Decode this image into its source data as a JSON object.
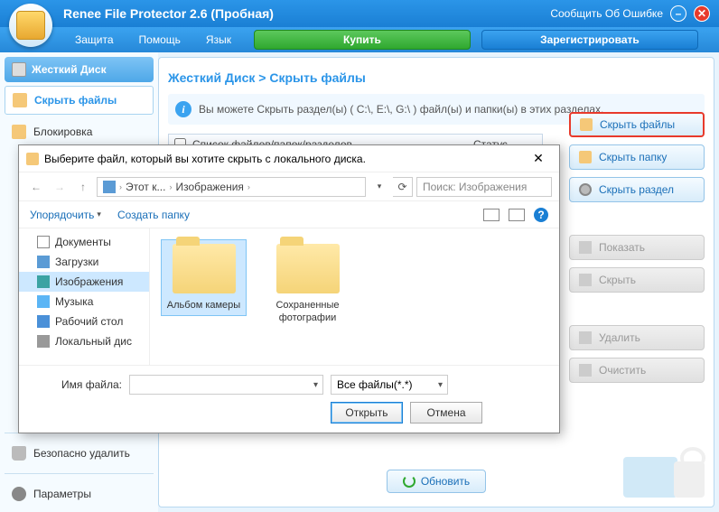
{
  "titlebar": {
    "title": "Renee File Protector 2.6 (Пробная)",
    "report": "Сообщить Об Ошибке"
  },
  "menu": {
    "protect": "Защита",
    "help": "Помощь",
    "lang": "Язык",
    "buy": "Купить",
    "register": "Зарегистрировать"
  },
  "sidebar": {
    "disk_header": "Жесткий Диск",
    "hide_files": "Скрыть файлы",
    "lock": "Блокировка",
    "safe_delete": "Безопасно удалить",
    "params": "Параметры"
  },
  "content": {
    "breadcrumb": "Жесткий Диск > Скрыть файлы",
    "info": "Вы можете Скрыть раздел(ы) ( C:\\, E:\\, G:\\ ) файл(ы) и папки(ы) в этих разделах.",
    "th_list": "Список файлов/папок/разделов",
    "th_status": "Статус",
    "refresh": "Обновить"
  },
  "actions": {
    "hide_files": "Скрыть файлы",
    "hide_folder": "Скрыть папку",
    "hide_partition": "Скрыть раздел",
    "show": "Показать",
    "hide": "Скрыть",
    "delete": "Удалить",
    "clear": "Очистить"
  },
  "dialog": {
    "title": "Выберите файл, который вы хотите скрыть с локального диска.",
    "path_pc": "Этот к...",
    "path_img": "Изображения",
    "search_ph": "Поиск: Изображения",
    "organize": "Упорядочить",
    "new_folder": "Создать папку",
    "tree": {
      "docs": "Документы",
      "downloads": "Загрузки",
      "images": "Изображения",
      "music": "Музыка",
      "desktop": "Рабочий стол",
      "localdisk": "Локальный дис"
    },
    "files": {
      "f1": "Альбом камеры",
      "f2": "Сохраненные фотографии"
    },
    "filename_label": "Имя файла:",
    "filter": "Все файлы(*.*)",
    "open": "Открыть",
    "cancel": "Отмена"
  }
}
